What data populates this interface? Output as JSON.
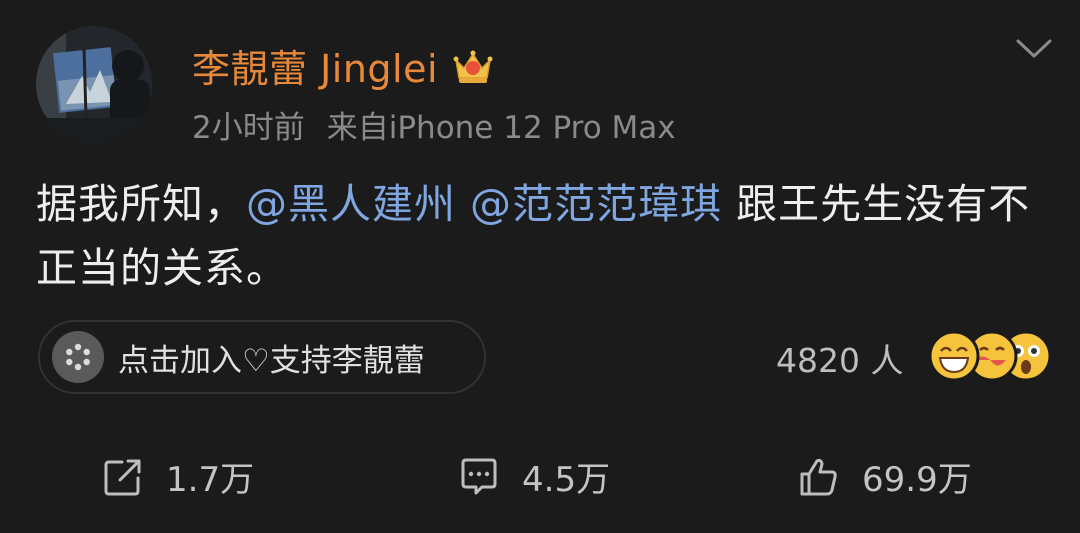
{
  "post": {
    "username": "李靚蕾 Jinglei",
    "time": "2小时前",
    "source": "来自iPhone 12 Pro Max",
    "content": {
      "prefix": "据我所知，",
      "mention1": "@黑人建州",
      "mention2": "@范范范瑋琪",
      "suffix": "跟王先生没有不正当的关系。"
    }
  },
  "support": {
    "label": "点击加入♡支持李靚蕾",
    "count": "4820 人"
  },
  "actions": {
    "repost": "1.7万",
    "comment": "4.5万",
    "like": "69.9万"
  },
  "colors": {
    "background": "#1b1b1b",
    "username": "#e8893a",
    "mention": "#7fa6e0",
    "meta": "#8a8a8a"
  },
  "icons": [
    "crown-badge-icon",
    "chevron-down-icon",
    "asterisk-icon",
    "repost-icon",
    "comment-icon",
    "like-icon"
  ]
}
